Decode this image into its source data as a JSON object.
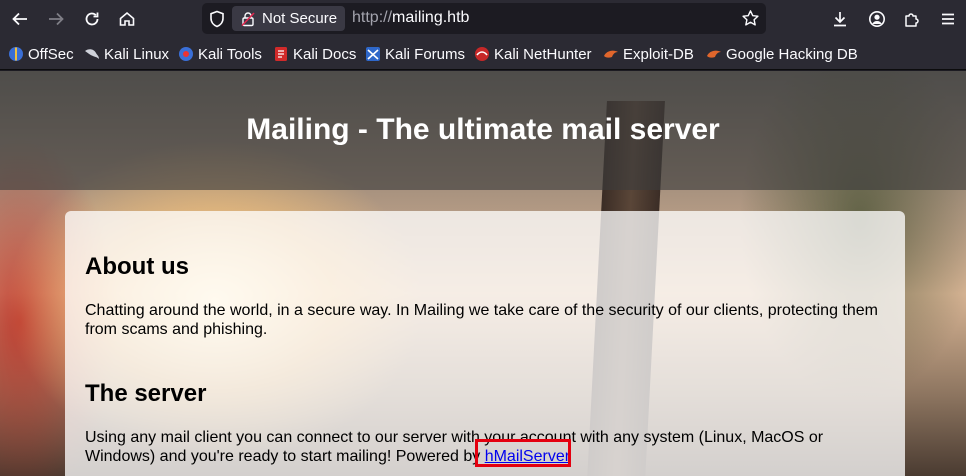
{
  "browser": {
    "security_label": "Not Secure",
    "url_scheme": "http://",
    "url_host": "mailing.htb"
  },
  "bookmarks": [
    {
      "label": "OffSec",
      "icon": "offsec-icon"
    },
    {
      "label": "Kali Linux",
      "icon": "kali-dragon-icon"
    },
    {
      "label": "Kali Tools",
      "icon": "kali-tools-icon"
    },
    {
      "label": "Kali Docs",
      "icon": "kali-docs-icon"
    },
    {
      "label": "Kali Forums",
      "icon": "kali-forums-icon"
    },
    {
      "label": "Kali NetHunter",
      "icon": "nethunter-icon"
    },
    {
      "label": "Exploit-DB",
      "icon": "exploit-db-icon"
    },
    {
      "label": "Google Hacking DB",
      "icon": "ghdb-icon"
    }
  ],
  "page": {
    "title": "Mailing - The ultimate mail server",
    "about_heading": "About us",
    "about_text": "Chatting around the world, in a secure way. In Mailing we take care of the security of our clients, protecting them from scams and phishing.",
    "server_heading": "The server",
    "server_text_before": "Using any mail client you can connect to our server with your account with any system (Linux, MacOS or Windows) and you're ready to start mailing! Powered by ",
    "server_link": "hMailServer"
  },
  "colors": {
    "chrome_bg": "#2b2a33",
    "urlbar_bg": "#1c1b22",
    "link": "#0000ee",
    "highlight_box": "#e4000f"
  }
}
